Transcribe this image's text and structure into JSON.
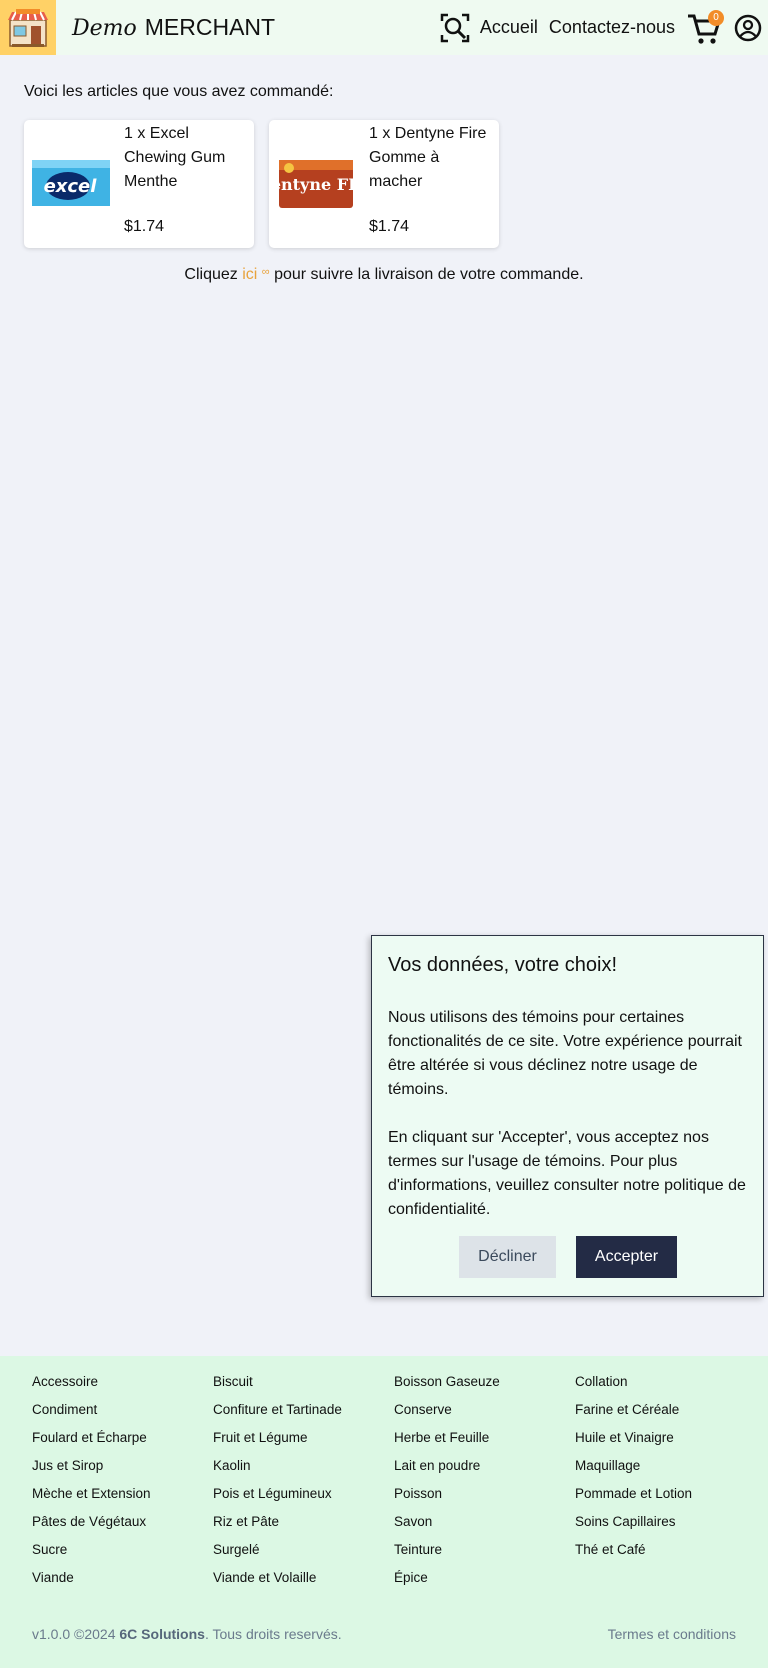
{
  "header": {
    "brand_script": "Demo",
    "brand_name": "MERCHANT",
    "nav": [
      "Accueil",
      "Contactez-nous"
    ],
    "cart_count": "0"
  },
  "main": {
    "intro": "Voici les articles que vous avez commandé:",
    "products": [
      {
        "name": "1 x Excel Chewing Gum Menthe",
        "price": "$1.74",
        "image_text": "excel"
      },
      {
        "name": "1 x Dentyne Fire Gomme à macher",
        "price": "$1.74",
        "image_text": "Dentyne FIRE"
      }
    ],
    "track_before": "Cliquez ",
    "track_link": "ici",
    "track_after": " pour suivre la livraison de votre commande."
  },
  "cookie": {
    "title": "Vos données, votre choix!",
    "text1": "Nous utilisons des témoins pour certaines fonctionalités de ce site. Votre expérience pourrait être altérée si vous déclinez notre usage de témoins.",
    "text2": "En cliquant sur 'Accepter', vous acceptez nos termes sur l'usage de témoins. Pour plus d'informations, veuillez consulter notre politique de confidentialité.",
    "decline": "Décliner",
    "accept": "Accepter"
  },
  "footer": {
    "categories": [
      "Accessoire",
      "Biscuit",
      "Boisson Gaseuze",
      "Collation",
      "Condiment",
      "Confiture et Tartinade",
      "Conserve",
      "Farine et Céréale",
      "Foulard et Écharpe",
      "Fruit et Légume",
      "Herbe et Feuille",
      "Huile et Vinaigre",
      "Jus et Sirop",
      "Kaolin",
      "Lait en poudre",
      "Maquillage",
      "Mèche et Extension",
      "Pois et Légumineux",
      "Poisson",
      "Pommade et Lotion",
      "Pâtes de Végétaux",
      "Riz et Pâte",
      "Savon",
      "Soins Capillaires",
      "Sucre",
      "Surgelé",
      "Teinture",
      "Thé et Café",
      "Viande",
      "Viande et Volaille",
      "Épice"
    ],
    "version": "v1.0.0 ©2024 ",
    "company": "6C Solutions",
    "rights": ". Tous droits reservés.",
    "terms": "Termes et conditions"
  },
  "colors": {
    "accent": "#e8a33d",
    "badge": "#f28c28",
    "accept_button": "#232b45",
    "footer_bg": "#dcf8e4"
  }
}
